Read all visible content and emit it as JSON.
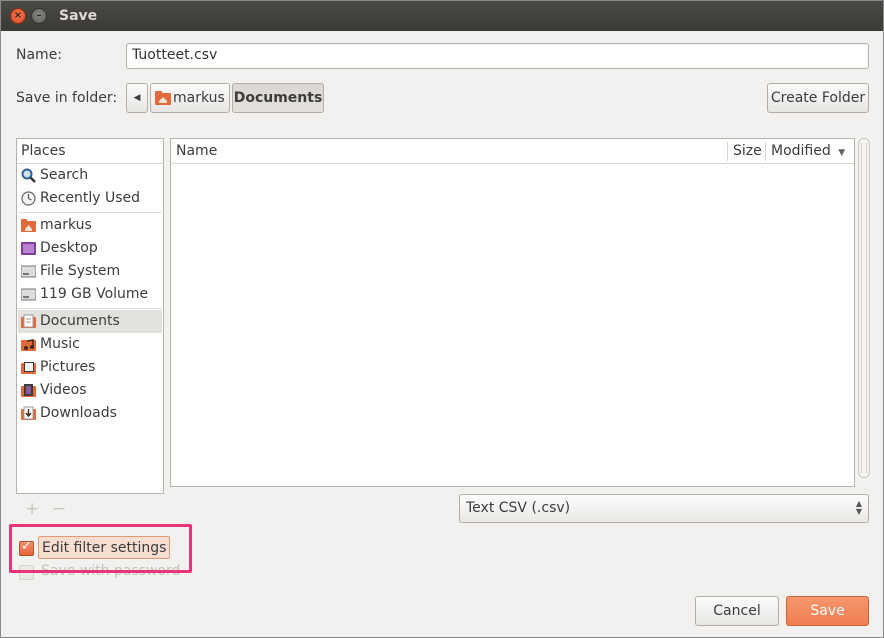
{
  "window": {
    "title": "Save"
  },
  "name_row": {
    "label": "Name:",
    "value": "Tuotteet.csv"
  },
  "folder_row": {
    "label": "Save in folder:",
    "path": [
      "markus",
      "Documents"
    ],
    "create_folder": "Create Folder"
  },
  "places": {
    "header": "Places",
    "items": [
      {
        "label": "Search",
        "icon": "search-icon"
      },
      {
        "label": "Recently Used",
        "icon": "clock-icon"
      },
      {
        "label": "markus",
        "icon": "home-folder-icon"
      },
      {
        "label": "Desktop",
        "icon": "desktop-icon"
      },
      {
        "label": "File System",
        "icon": "drive-icon"
      },
      {
        "label": "119 GB Volume",
        "icon": "drive-icon"
      },
      {
        "label": "Documents",
        "icon": "documents-folder-icon",
        "selected": true
      },
      {
        "label": "Music",
        "icon": "music-folder-icon"
      },
      {
        "label": "Pictures",
        "icon": "pictures-folder-icon"
      },
      {
        "label": "Videos",
        "icon": "videos-folder-icon"
      },
      {
        "label": "Downloads",
        "icon": "downloads-folder-icon"
      }
    ]
  },
  "files": {
    "columns": {
      "name": "Name",
      "size": "Size",
      "modified": "Modified"
    }
  },
  "filter": {
    "selected": "Text CSV (.csv)"
  },
  "options": {
    "edit_filter": {
      "label": "Edit filter settings",
      "checked": true
    },
    "save_password": {
      "label": "Save with password",
      "checked": false,
      "enabled": false
    }
  },
  "buttons": {
    "cancel": "Cancel",
    "save": "Save"
  },
  "colors": {
    "accent": "#ef7e50",
    "highlight": "#e8357a"
  }
}
